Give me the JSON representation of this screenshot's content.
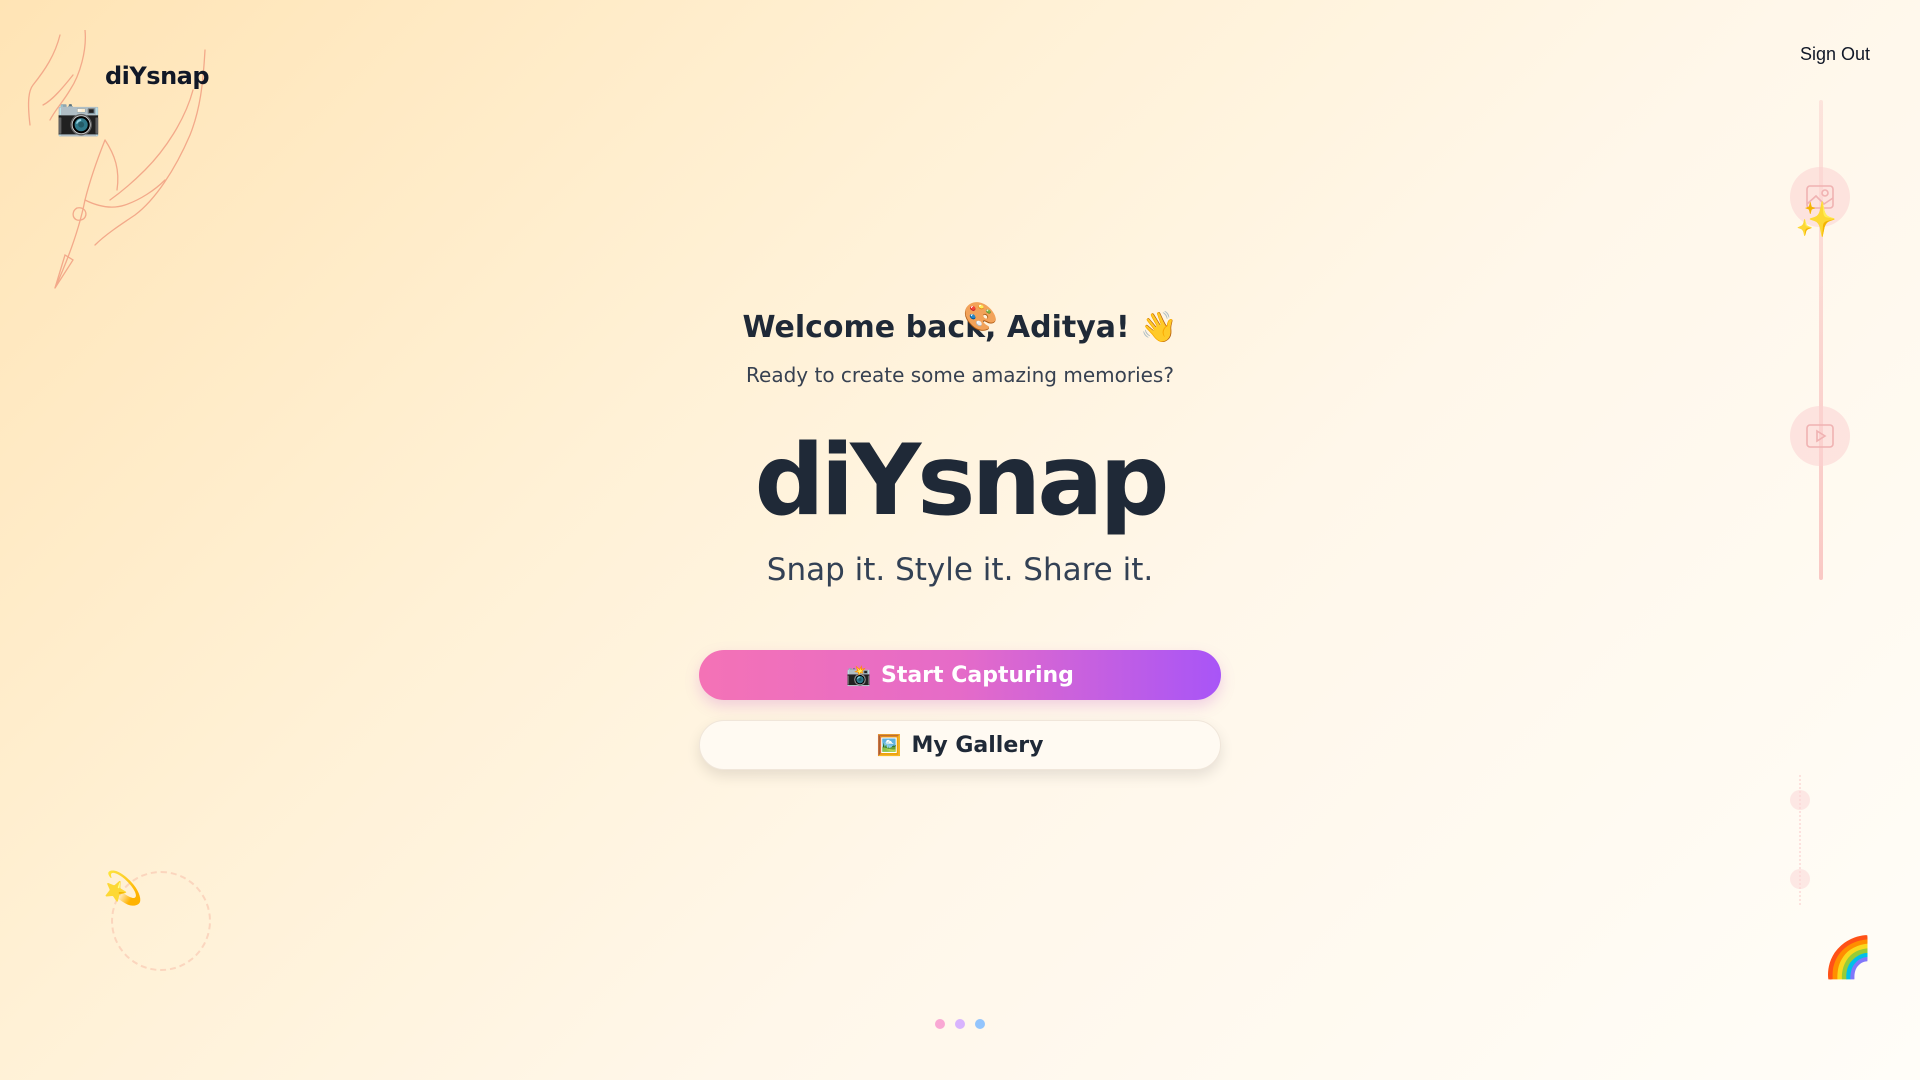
{
  "header": {
    "brand": "diYsnap",
    "sign_out_label": "Sign Out"
  },
  "main": {
    "welcome": "Welcome back, Aditya! 👋",
    "subtitle": "Ready to create some amazing memories?",
    "hero_title": "diYsnap",
    "tagline": "Snap it. Style it. Share it.",
    "primary_button": {
      "icon": "📸",
      "label": "Start Capturing"
    },
    "secondary_button": {
      "icon": "🖼️",
      "label": "My Gallery"
    }
  },
  "decorations": {
    "camera": "📷",
    "palette": "🎨",
    "sparkles": "✨",
    "dizzy": "💫",
    "rainbow": "🌈"
  },
  "icons": {
    "image_icon": "image-icon",
    "video_icon": "video-icon"
  },
  "pager": {
    "colors": [
      "#f9a8d4",
      "#d8b4fe",
      "#93c5fd"
    ]
  },
  "colors": {
    "primary_gradient_start": "#f472b6",
    "primary_gradient_end": "#a855f7",
    "text_dark": "#1f2937"
  }
}
